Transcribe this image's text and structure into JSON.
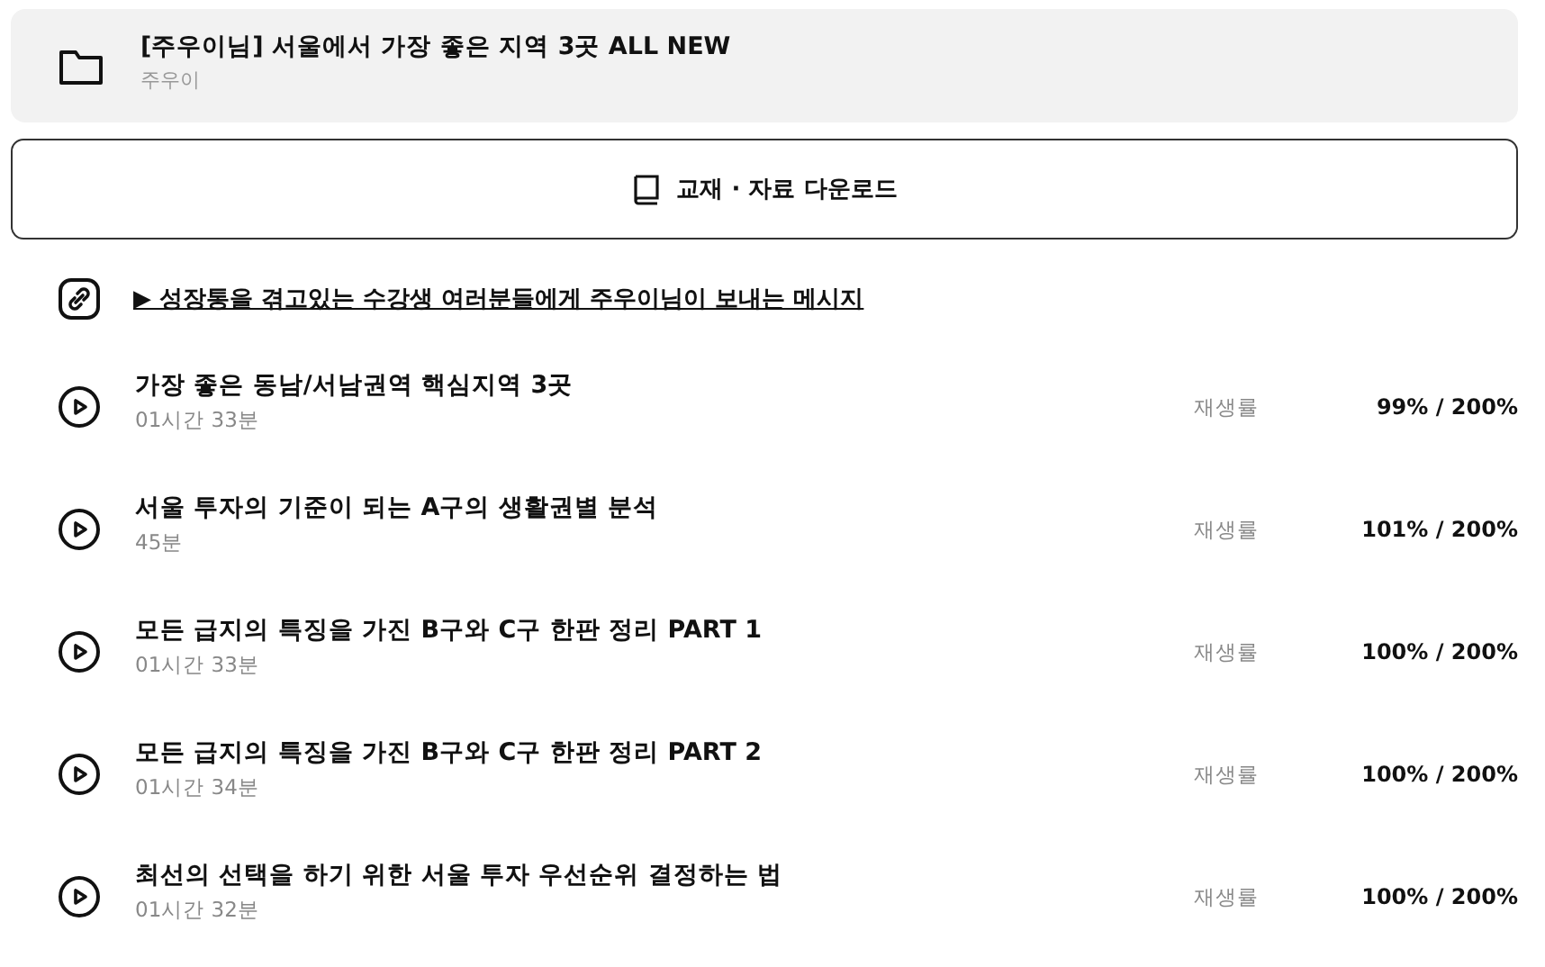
{
  "course": {
    "title": "[주우이님] 서울에서 가장 좋은 지역 3곳 ALL NEW",
    "author": "주우이"
  },
  "download_button": {
    "label": "교재 · 자료 다운로드"
  },
  "message_link": {
    "label": "▶ 성장통을 겪고있는 수강생 여러분들에게 주우이님이 보내는 메시지"
  },
  "lessons": [
    {
      "title": "가장 좋은 동남/서남권역 핵심지역 3곳",
      "duration": "01시간 33분",
      "rate_label": "재생률",
      "rate": "99% / 200%"
    },
    {
      "title": "서울 투자의 기준이 되는 A구의 생활권별 분석",
      "duration": "45분",
      "rate_label": "재생률",
      "rate": "101% / 200%"
    },
    {
      "title": "모든 급지의 특징을 가진 B구와 C구 한판 정리 PART 1",
      "duration": "01시간 33분",
      "rate_label": "재생률",
      "rate": "100% / 200%"
    },
    {
      "title": "모든 급지의 특징을 가진 B구와 C구 한판 정리 PART 2",
      "duration": "01시간 34분",
      "rate_label": "재생률",
      "rate": "100% / 200%"
    },
    {
      "title": "최선의 선택을 하기 위한 서울 투자 우선순위 결정하는 법",
      "duration": "01시간 32분",
      "rate_label": "재생률",
      "rate": "100% / 200%"
    }
  ]
}
